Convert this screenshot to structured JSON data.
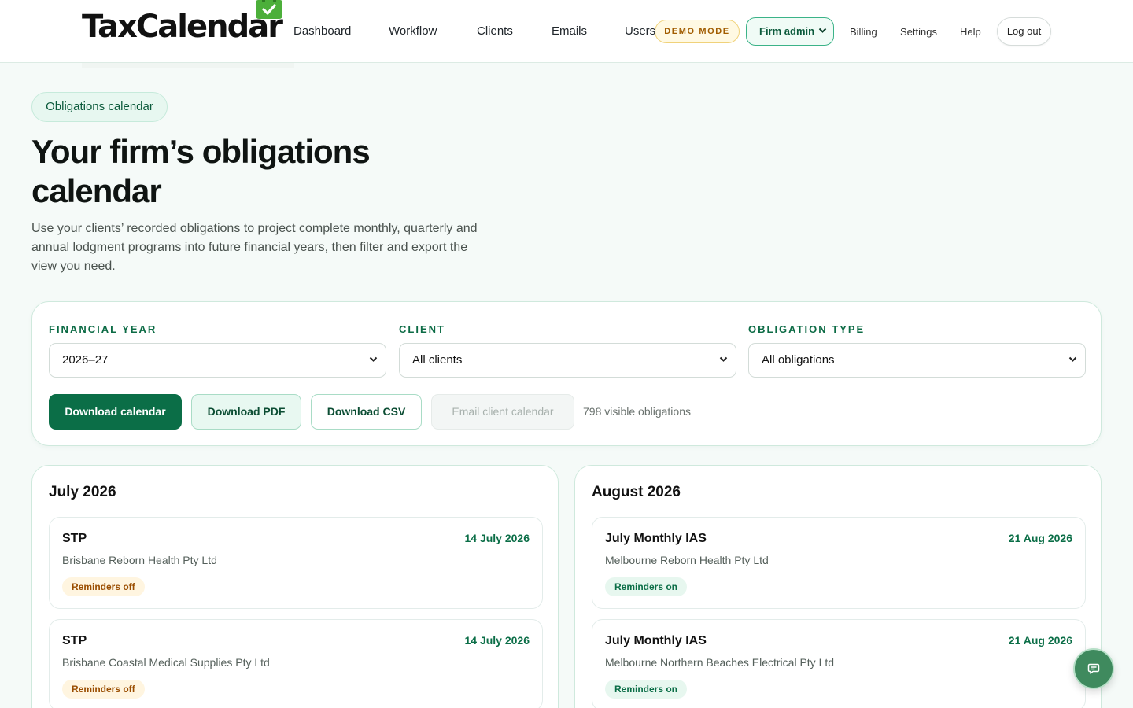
{
  "brand": {
    "logo_text": "TaxCalendar"
  },
  "nav": {
    "items": [
      "Dashboard",
      "Workflow",
      "Clients",
      "Emails",
      "Users"
    ],
    "demo_badge": "DEMO MODE",
    "role_select": "Firm admin",
    "links": [
      "Billing",
      "Settings",
      "Help"
    ],
    "logout": "Log out"
  },
  "hero": {
    "pill": "Obligations calendar",
    "title": "Your firm’s obligations calendar",
    "lead": "Use your clients’ recorded obligations to project complete monthly, quarterly and annual lodgment programs into future financial years, then filter and export the view you need."
  },
  "filters": {
    "financial_year": {
      "label": "FINANCIAL YEAR",
      "value": "2026–27"
    },
    "client": {
      "label": "CLIENT",
      "value": "All clients"
    },
    "obligation_type": {
      "label": "OBLIGATION TYPE",
      "value": "All obligations"
    },
    "buttons": {
      "download_calendar": "Download calendar",
      "download_pdf": "Download PDF",
      "download_csv": "Download CSV",
      "email_client": "Email client calendar"
    },
    "visible_count": "798 visible obligations"
  },
  "months": [
    {
      "title": "July 2026",
      "items": [
        {
          "name": "STP",
          "date": "14 July 2026",
          "client": "Brisbane Reborn Health Pty Ltd",
          "reminder": "Reminders off"
        },
        {
          "name": "STP",
          "date": "14 July 2026",
          "client": "Brisbane Coastal Medical Supplies Pty Ltd",
          "reminder": "Reminders off"
        }
      ]
    },
    {
      "title": "August 2026",
      "items": [
        {
          "name": "July Monthly IAS",
          "date": "21 Aug 2026",
          "client": "Melbourne Reborn Health Pty Ltd",
          "reminder": "Reminders on"
        },
        {
          "name": "July Monthly IAS",
          "date": "21 Aug 2026",
          "client": "Melbourne Northern Beaches Electrical Pty Ltd",
          "reminder": "Reminders on"
        }
      ]
    }
  ],
  "colors": {
    "brand_green": "#0b6e47",
    "accent_logo": "#4caf3a",
    "demo_amber": "#a15c00"
  },
  "icons": {
    "chat": "chat-bubble-icon",
    "chevron": "chevron-down-icon",
    "logo": "calendar-check-icon"
  }
}
